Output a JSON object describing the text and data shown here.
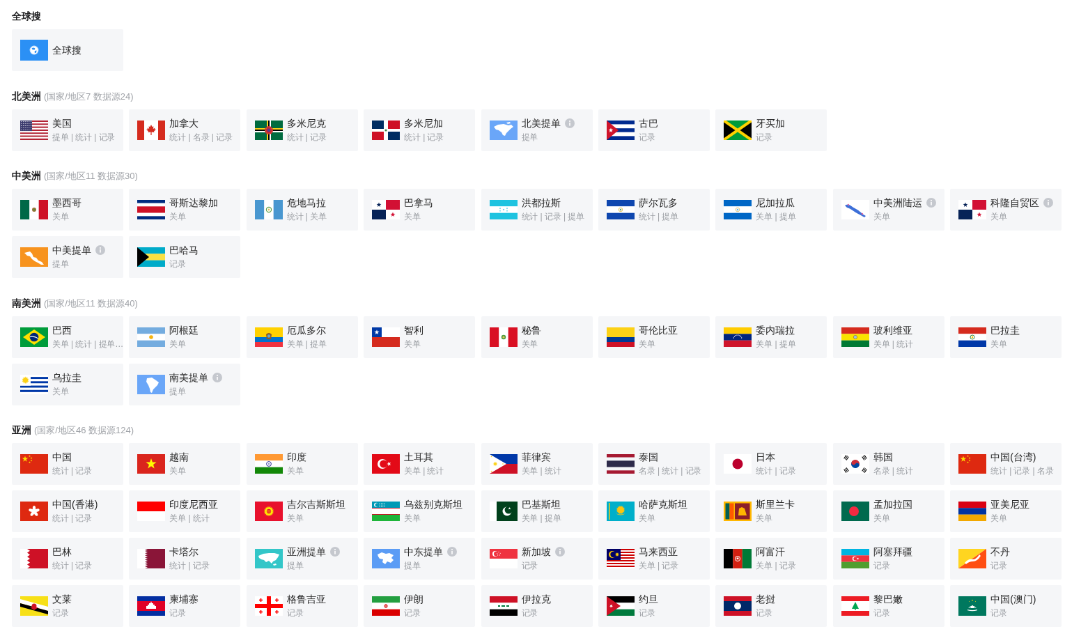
{
  "sections": [
    {
      "title": "全球搜",
      "items": [
        {
          "name": "全球搜",
          "kind": "globe",
          "info": false
        }
      ]
    },
    {
      "title": "北美洲",
      "count": "(国家/地区7 数据源24)",
      "items": [
        {
          "name": "美国",
          "kind": "us",
          "sub": "提单 | 统计 | 记录",
          "info": false
        },
        {
          "name": "加拿大",
          "kind": "ca",
          "sub": "统计 | 名录 | 记录",
          "info": false
        },
        {
          "name": "多米尼克",
          "kind": "dm",
          "sub": "统计 | 记录",
          "info": false
        },
        {
          "name": "多米尼加",
          "kind": "do",
          "sub": "统计 | 记录",
          "info": false
        },
        {
          "name": "北美提单",
          "kind": "namap",
          "sub": "提单",
          "info": true
        },
        {
          "name": "古巴",
          "kind": "cu",
          "sub": "记录",
          "info": false
        },
        {
          "name": "牙买加",
          "kind": "jm",
          "sub": "记录",
          "info": false
        }
      ]
    },
    {
      "title": "中美洲",
      "count": "(国家/地区11 数据源30)",
      "items": [
        {
          "name": "墨西哥",
          "kind": "mx",
          "sub": "关单",
          "info": false
        },
        {
          "name": "哥斯达黎加",
          "kind": "cr",
          "sub": "关单",
          "info": false
        },
        {
          "name": "危地马拉",
          "kind": "gt",
          "sub": "统计 | 关单",
          "info": false
        },
        {
          "name": "巴拿马",
          "kind": "pa",
          "sub": "关单",
          "info": false
        },
        {
          "name": "洪都拉斯",
          "kind": "hn",
          "sub": "统计 | 记录 | 提单",
          "info": false
        },
        {
          "name": "萨尔瓦多",
          "kind": "sv",
          "sub": "统计 | 提单",
          "info": false
        },
        {
          "name": "尼加拉瓜",
          "kind": "ni",
          "sub": "关单 | 提单",
          "info": false
        },
        {
          "name": "中美洲陆运",
          "kind": "calogistics",
          "sub": "关单",
          "info": true
        },
        {
          "name": "科隆自贸区",
          "kind": "pa",
          "sub": "关单",
          "info": true
        },
        {
          "name": "中美提单",
          "kind": "camap",
          "sub": "提单",
          "info": true
        },
        {
          "name": "巴哈马",
          "kind": "bs",
          "sub": "记录",
          "info": false
        }
      ]
    },
    {
      "title": "南美洲",
      "count": "(国家/地区11 数据源40)",
      "items": [
        {
          "name": "巴西",
          "kind": "br",
          "sub": "关单 | 统计 | 提单…",
          "info": false
        },
        {
          "name": "阿根廷",
          "kind": "ar",
          "sub": "关单",
          "info": false
        },
        {
          "name": "厄瓜多尔",
          "kind": "ec",
          "sub": "关单 | 提单",
          "info": false
        },
        {
          "name": "智利",
          "kind": "cl",
          "sub": "关单",
          "info": false
        },
        {
          "name": "秘鲁",
          "kind": "pe",
          "sub": "关单",
          "info": false
        },
        {
          "name": "哥伦比亚",
          "kind": "co",
          "sub": "关单",
          "info": false
        },
        {
          "name": "委内瑞拉",
          "kind": "ve",
          "sub": "关单 | 提单",
          "info": false
        },
        {
          "name": "玻利维亚",
          "kind": "bo",
          "sub": "关单 | 统计",
          "info": false
        },
        {
          "name": "巴拉圭",
          "kind": "py",
          "sub": "关单",
          "info": false
        },
        {
          "name": "乌拉圭",
          "kind": "uy",
          "sub": "关单",
          "info": false
        },
        {
          "name": "南美提单",
          "kind": "samap",
          "sub": "提单",
          "info": true
        }
      ]
    },
    {
      "title": "亚洲",
      "count": "(国家/地区46 数据源124)",
      "items": [
        {
          "name": "中国",
          "kind": "cn",
          "sub": "统计 | 记录",
          "info": false
        },
        {
          "name": "越南",
          "kind": "vn",
          "sub": "关单",
          "info": false
        },
        {
          "name": "印度",
          "kind": "in",
          "sub": "关单",
          "info": false
        },
        {
          "name": "土耳其",
          "kind": "tr",
          "sub": "关单 | 统计",
          "info": false
        },
        {
          "name": "菲律宾",
          "kind": "ph",
          "sub": "关单 | 统计",
          "info": false
        },
        {
          "name": "泰国",
          "kind": "th",
          "sub": "名录 | 统计 | 记录",
          "info": false
        },
        {
          "name": "日本",
          "kind": "jp",
          "sub": "统计 | 记录",
          "info": false
        },
        {
          "name": "韩国",
          "kind": "kr",
          "sub": "名录 | 统计",
          "info": false
        },
        {
          "name": "中国(台湾)",
          "kind": "cn",
          "sub": "统计 | 记录 | 名录",
          "info": false
        },
        {
          "name": "中国(香港)",
          "kind": "hk",
          "sub": "统计 | 记录",
          "info": false
        },
        {
          "name": "印度尼西亚",
          "kind": "id",
          "sub": "关单 | 统计",
          "info": false
        },
        {
          "name": "吉尔吉斯斯坦",
          "kind": "kg",
          "sub": "关单",
          "info": false
        },
        {
          "name": "乌兹别克斯坦",
          "kind": "uz",
          "sub": "关单",
          "info": false
        },
        {
          "name": "巴基斯坦",
          "kind": "pk",
          "sub": "关单 | 提单",
          "info": false
        },
        {
          "name": "哈萨克斯坦",
          "kind": "kz",
          "sub": "关单",
          "info": false
        },
        {
          "name": "斯里兰卡",
          "kind": "lk",
          "sub": "关单",
          "info": false
        },
        {
          "name": "孟加拉国",
          "kind": "bd",
          "sub": "关单",
          "info": false
        },
        {
          "name": "亚美尼亚",
          "kind": "am",
          "sub": "关单",
          "info": false
        },
        {
          "name": "巴林",
          "kind": "bh",
          "sub": "统计 | 记录",
          "info": false
        },
        {
          "name": "卡塔尔",
          "kind": "qa",
          "sub": "统计 | 记录",
          "info": false
        },
        {
          "name": "亚洲提单",
          "kind": "asiamap",
          "sub": "提单",
          "info": true
        },
        {
          "name": "中东提单",
          "kind": "memap",
          "sub": "提单",
          "info": true
        },
        {
          "name": "新加坡",
          "kind": "sg",
          "sub": "记录",
          "info": true
        },
        {
          "name": "马来西亚",
          "kind": "my",
          "sub": "关单 | 记录",
          "info": false
        },
        {
          "name": "阿富汗",
          "kind": "af",
          "sub": "关单 | 记录",
          "info": false
        },
        {
          "name": "阿塞拜疆",
          "kind": "az",
          "sub": "记录",
          "info": false
        },
        {
          "name": "不丹",
          "kind": "bt",
          "sub": "记录",
          "info": false
        },
        {
          "name": "文莱",
          "kind": "bn",
          "sub": "记录",
          "info": false
        },
        {
          "name": "柬埔寨",
          "kind": "kh",
          "sub": "记录",
          "info": false
        },
        {
          "name": "格鲁吉亚",
          "kind": "ge",
          "sub": "记录",
          "info": false
        },
        {
          "name": "伊朗",
          "kind": "ir",
          "sub": "记录",
          "info": false
        },
        {
          "name": "伊拉克",
          "kind": "iq",
          "sub": "记录",
          "info": false
        },
        {
          "name": "约旦",
          "kind": "jo",
          "sub": "记录",
          "info": false
        },
        {
          "name": "老挝",
          "kind": "la",
          "sub": "记录",
          "info": false
        },
        {
          "name": "黎巴嫩",
          "kind": "lb",
          "sub": "记录",
          "info": false
        },
        {
          "name": "中国(澳门)",
          "kind": "mo",
          "sub": "记录",
          "info": false
        }
      ]
    }
  ]
}
